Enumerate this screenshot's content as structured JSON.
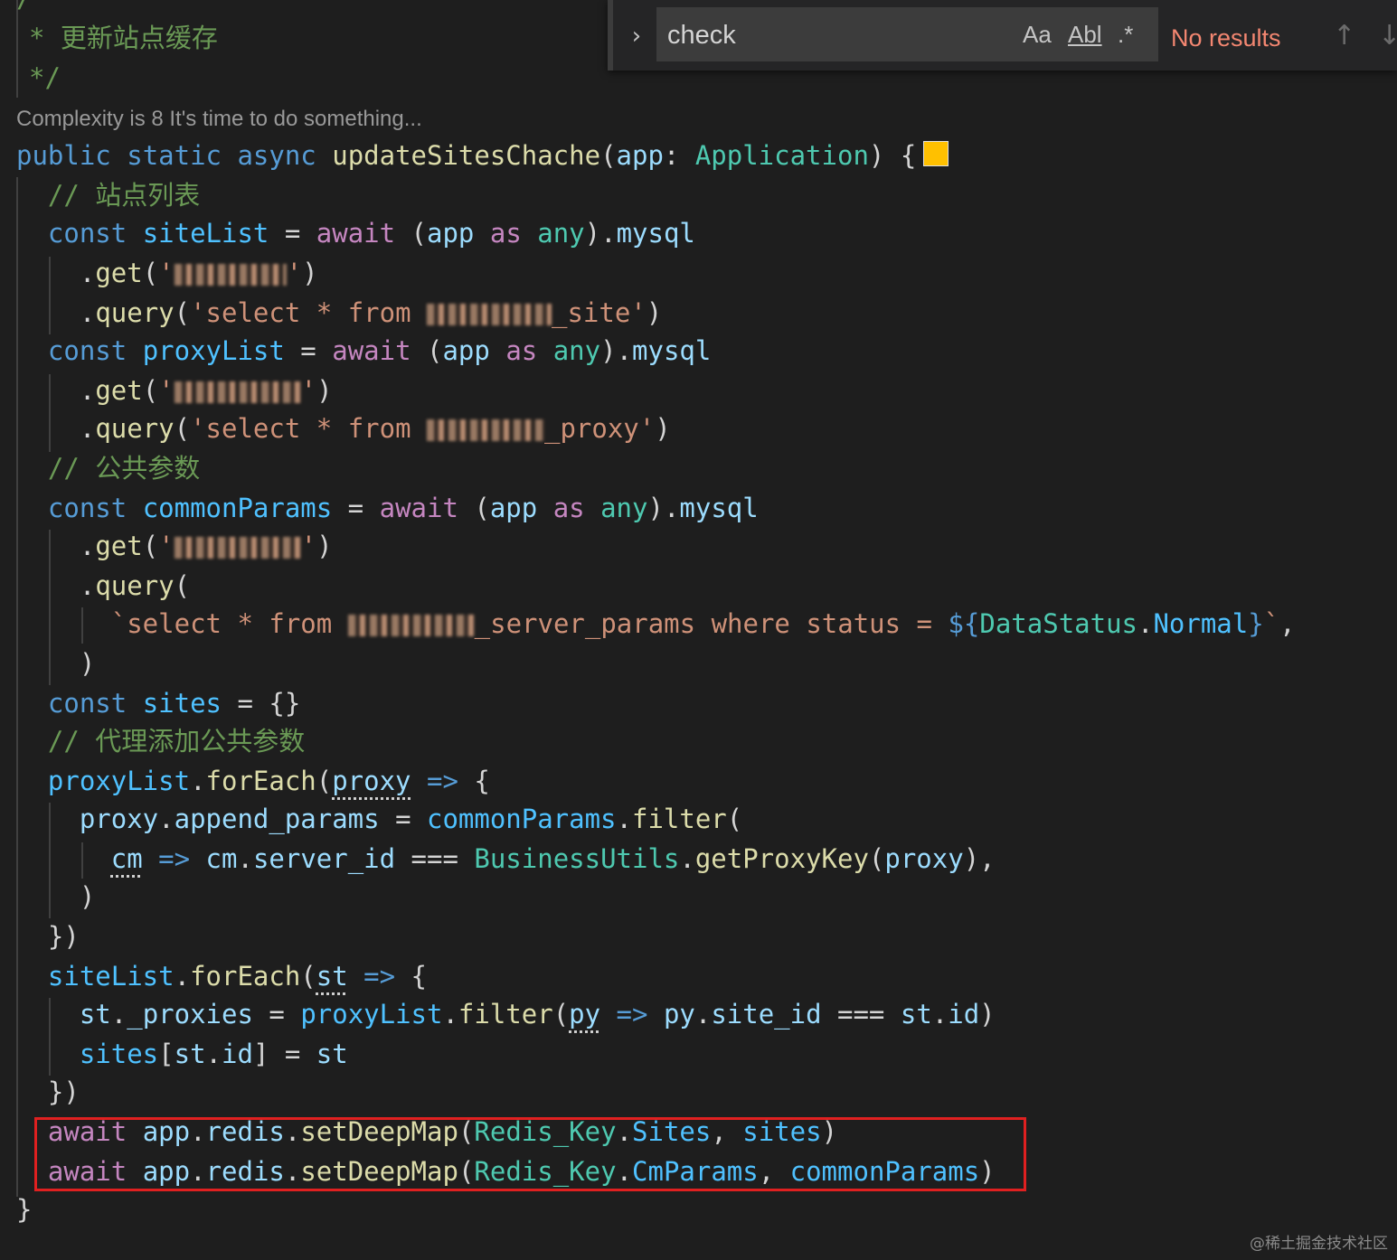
{
  "find_widget": {
    "query": "check",
    "match_case_label": "Aa",
    "whole_word_label": "Abl",
    "regex_label": ".*",
    "result_text": "No results",
    "prev_icon": "arrow-up-icon",
    "next_icon": "arrow-down-icon",
    "toggle_icon": "chevron-right-icon"
  },
  "code": {
    "top_fragment": "/**",
    "doc_comment_line": "* 更新站点缓存",
    "doc_comment_end": "*/",
    "codelens": "Complexity is 8 It's time to do something...",
    "comment_site_list": "// 站点列表",
    "comment_common_params": "// 公共参数",
    "comment_proxy_params": "// 代理添加公共参数",
    "str_select_from": "'select * from ",
    "str_site_suffix": "_site'",
    "str_proxy_suffix": "_proxy'",
    "tpl_select": "`select * from ",
    "tpl_server_params": "_server_params where status = ",
    "tpl_expr_open": "${",
    "tpl_expr_close": "}",
    "tpl_end": "`",
    "id_update": "updateSitesChache",
    "id_app": "app",
    "id_application": "Application",
    "id_site_list": "siteList",
    "id_proxy_list": "proxyList",
    "id_common_params": "commonParams",
    "id_sites": "sites",
    "id_mysql": "mysql",
    "id_get": "get",
    "id_query": "query",
    "id_for_each": "forEach",
    "id_filter": "filter",
    "id_proxy": "proxy",
    "id_append_params": "append_params",
    "id_cm": "cm",
    "id_server_id": "server_id",
    "id_business_utils": "BusinessUtils",
    "id_get_proxy_key": "getProxyKey",
    "id_st": "st",
    "id_proxies": "_proxies",
    "id_py": "py",
    "id_site_id": "site_id",
    "id_id": "id",
    "id_data_status": "DataStatus",
    "id_normal": "Normal",
    "id_redis": "redis",
    "id_set_deep_map": "setDeepMap",
    "id_redis_key": "Redis_Key",
    "id_sites_const": "Sites",
    "id_cm_params": "CmParams",
    "kw_public": "public",
    "kw_static": "static",
    "kw_async": "async",
    "kw_const": "const",
    "kw_await": "await",
    "kw_as": "as",
    "kw_any": "any"
  },
  "colors": {
    "background": "#1e1e1e",
    "keyword": "#569cd6",
    "control": "#c586c0",
    "function": "#dcdcaa",
    "variable": "#9cdcfe",
    "type": "#4ec9b0",
    "string": "#ce9178",
    "comment": "#6a9955",
    "no_results": "#f48771",
    "highlight_border": "#e02020",
    "color_swatch": "#ffc000"
  },
  "watermark": "@稀土掘金技术社区"
}
